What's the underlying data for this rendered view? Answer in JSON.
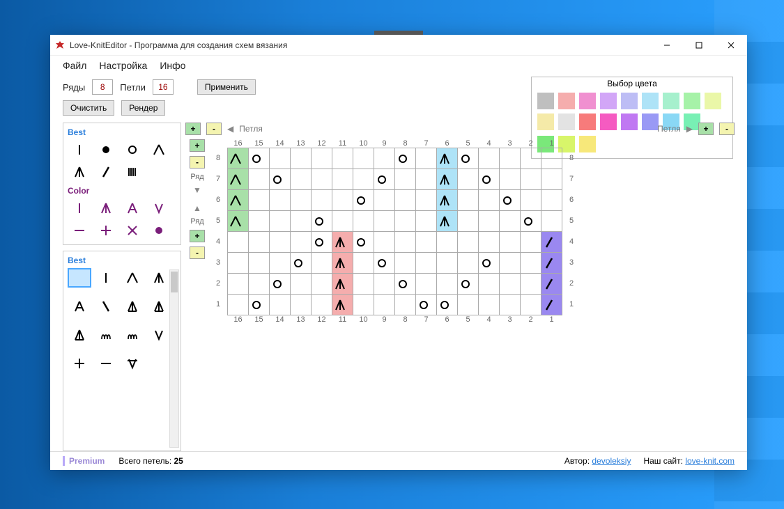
{
  "title": "Love-KnitEditor - Программа для создания схем вязания",
  "menu": {
    "file": "Файл",
    "settings": "Настройка",
    "info": "Инфо"
  },
  "labels": {
    "rows": "Ряды",
    "loops": "Петли",
    "apply": "Применить",
    "clear": "Очистить",
    "render": "Рендер",
    "colorpick": "Выбор цвета",
    "loop": "Петля",
    "row": "Ряд"
  },
  "inputs": {
    "rows": "8",
    "loops": "16"
  },
  "palBest": "Best",
  "palColor": "Color",
  "colors": [
    "#bfbfbf",
    "#f5adad",
    "#f090d0",
    "#d2a6f7",
    "#bdbdf5",
    "#aee3f7",
    "#a6f0cd",
    "#a6f2a8",
    "#eaf7a8",
    "#f5eaa8",
    "#e3e3e3",
    "#f77b7b",
    "#f55bc1",
    "#c078f2",
    "#9999f5",
    "#8ad8f5",
    "#78f0b4"
  ],
  "colors2": [
    "#7ae87a",
    "#d8f56a",
    "#f7e87a"
  ],
  "grid": {
    "cols": 16,
    "rows": 8,
    "cells": {
      "8,16": {
        "sym": "A2",
        "bg": "#a8e0a8"
      },
      "8,15": {
        "sym": "O"
      },
      "8,8": {
        "sym": "O"
      },
      "8,6": {
        "sym": "A1",
        "bg": "#aee3f7"
      },
      "8,5": {
        "sym": "O"
      },
      "7,16": {
        "sym": "A2",
        "bg": "#a8e0a8"
      },
      "7,14": {
        "sym": "O"
      },
      "7,9": {
        "sym": "O"
      },
      "7,6": {
        "sym": "A1",
        "bg": "#aee3f7"
      },
      "7,4": {
        "sym": "O"
      },
      "6,16": {
        "sym": "A2",
        "bg": "#a8e0a8"
      },
      "6,10": {
        "sym": "O"
      },
      "6,6": {
        "sym": "A1",
        "bg": "#aee3f7"
      },
      "6,3": {
        "sym": "O"
      },
      "5,16": {
        "sym": "A2",
        "bg": "#a8e0a8"
      },
      "5,12": {
        "sym": "O"
      },
      "5,6": {
        "sym": "A1",
        "bg": "#aee3f7"
      },
      "5,2": {
        "sym": "O"
      },
      "4,12": {
        "sym": "O"
      },
      "4,11": {
        "sym": "A1",
        "bg": "#f5adad"
      },
      "4,10": {
        "sym": "O"
      },
      "4,1": {
        "sym": "L",
        "bg": "#9a88f0"
      },
      "3,13": {
        "sym": "O"
      },
      "3,11": {
        "sym": "A1",
        "bg": "#f5adad"
      },
      "3,9": {
        "sym": "O"
      },
      "3,4": {
        "sym": "O"
      },
      "3,1": {
        "sym": "L",
        "bg": "#9a88f0"
      },
      "2,14": {
        "sym": "O"
      },
      "2,11": {
        "sym": "A1",
        "bg": "#f5adad"
      },
      "2,8": {
        "sym": "O"
      },
      "2,5": {
        "sym": "O"
      },
      "2,1": {
        "sym": "L",
        "bg": "#9a88f0"
      },
      "1,15": {
        "sym": "O"
      },
      "1,11": {
        "sym": "A1",
        "bg": "#f5adad"
      },
      "1,7": {
        "sym": "O"
      },
      "1,6": {
        "sym": "O"
      },
      "1,1": {
        "sym": "L",
        "bg": "#9a88f0"
      }
    }
  },
  "footer": {
    "premium": "Premium",
    "total": "Всего петель:",
    "totalNum": "25",
    "author": "Автор:",
    "authorLink": "devoleksiy",
    "site": "Наш сайт:",
    "siteLink": "love-knit.com"
  }
}
